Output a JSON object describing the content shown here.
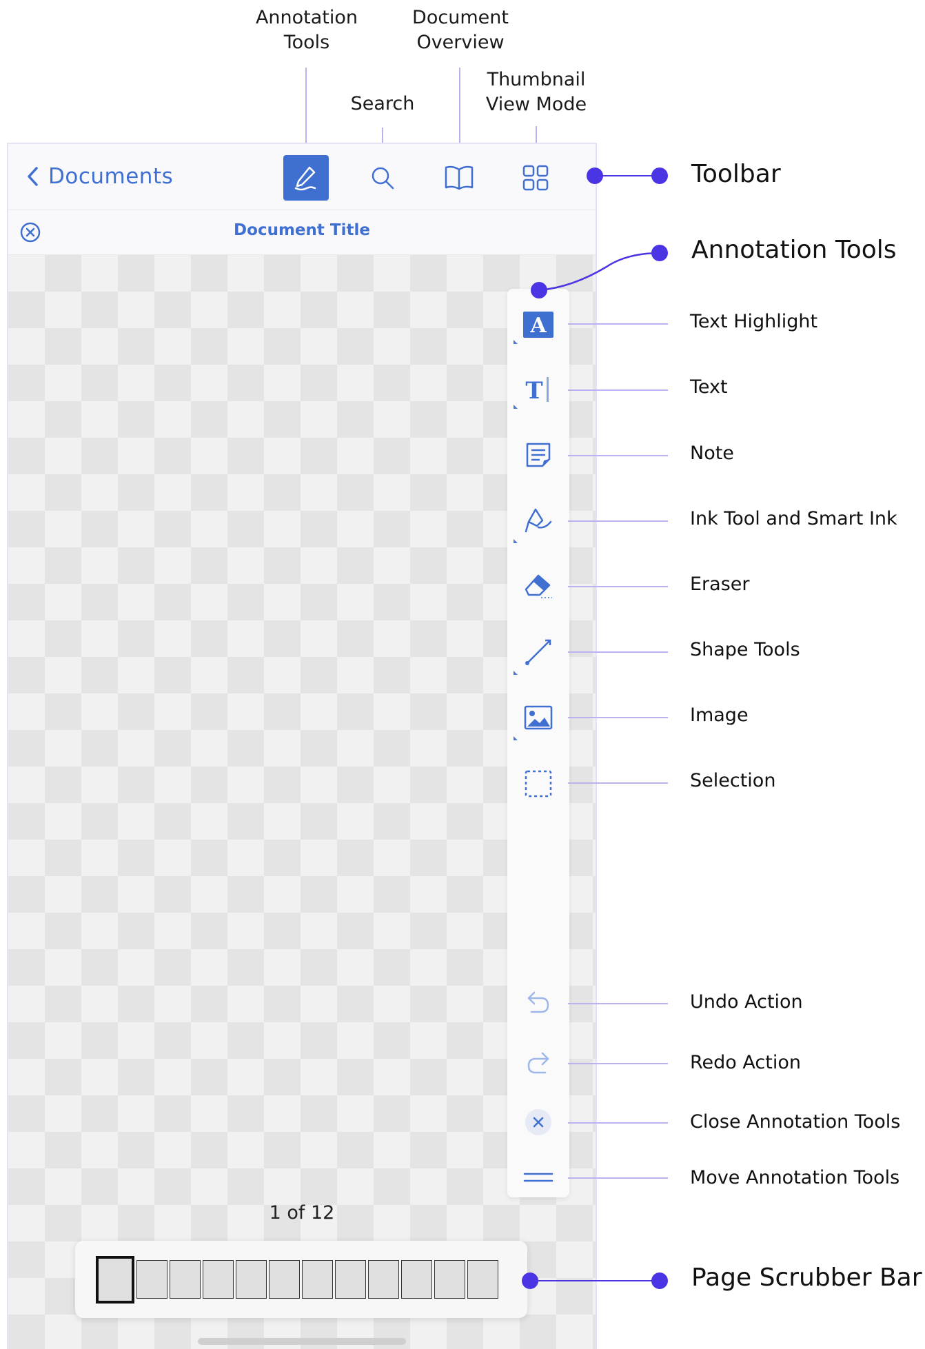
{
  "top_labels": {
    "annotation_tools": "Annotation\nTools",
    "search": "Search",
    "document_overview": "Document\nOverview",
    "thumbnail_view_mode": "Thumbnail\nView Mode"
  },
  "toolbar": {
    "back_label": "Documents",
    "icons": [
      "back-chevron-icon",
      "pencil-icon",
      "search-icon",
      "book-icon",
      "grid-icon"
    ]
  },
  "document": {
    "title": "Document Title"
  },
  "callouts": {
    "toolbar": "Toolbar",
    "annotation_tools": "Annotation Tools",
    "page_scrubber_bar": "Page Scrubber Bar"
  },
  "tools": [
    {
      "label": "Text Highlight",
      "icon": "text-highlight-icon"
    },
    {
      "label": "Text",
      "icon": "text-icon"
    },
    {
      "label": "Note",
      "icon": "note-icon"
    },
    {
      "label": "Ink Tool and Smart Ink",
      "icon": "ink-icon"
    },
    {
      "label": "Eraser",
      "icon": "eraser-icon"
    },
    {
      "label": "Shape Tools",
      "icon": "shape-icon"
    },
    {
      "label": "Image",
      "icon": "image-icon"
    },
    {
      "label": "Selection",
      "icon": "selection-icon"
    }
  ],
  "actions": [
    {
      "label": "Undo Action",
      "icon": "undo-icon"
    },
    {
      "label": "Redo Action",
      "icon": "redo-icon"
    },
    {
      "label": "Close Annotation Tools",
      "icon": "close-icon"
    },
    {
      "label": "Move Annotation Tools",
      "icon": "drag-handle-icon"
    }
  ],
  "page_indicator": "1 of 12",
  "scrubber": {
    "page_count": 12,
    "current_page": 1
  },
  "colors": {
    "accent": "#3f6fd0",
    "callout": "#4a34e4",
    "leader": "#b9b3f2"
  }
}
